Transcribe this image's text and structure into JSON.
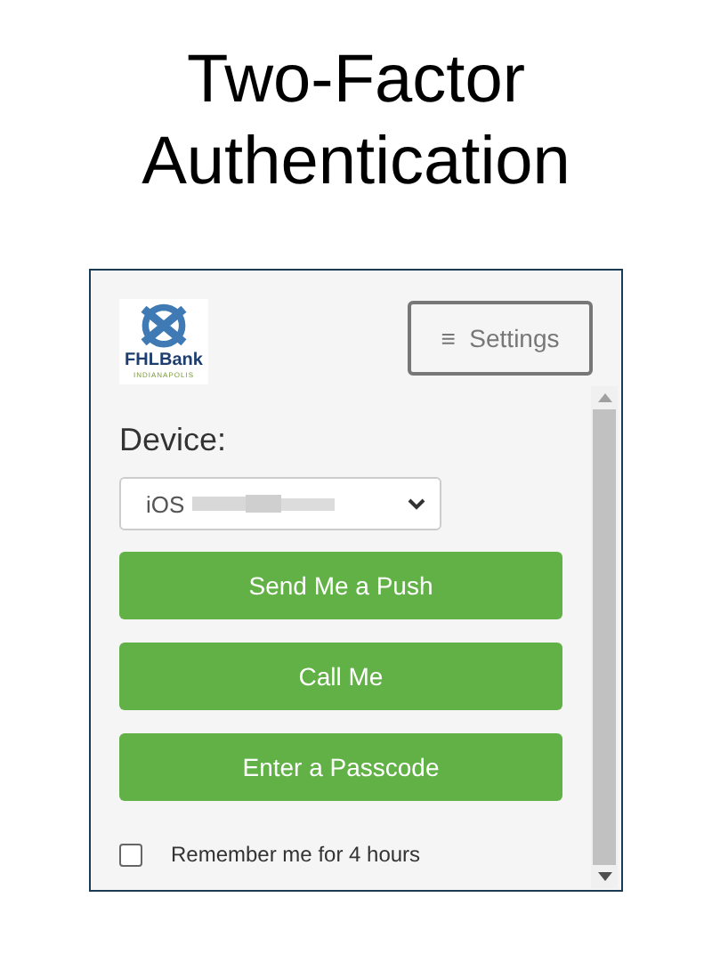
{
  "title": "Two-Factor Authentication",
  "logo": {
    "name": "FHLBank",
    "subtitle": "INDIANAPOLIS"
  },
  "settings_button": {
    "icon": "≡",
    "label": "Settings"
  },
  "device": {
    "label": "Device:",
    "value": "iOS"
  },
  "buttons": [
    "Send Me a Push",
    "Call Me",
    "Enter a Passcode"
  ],
  "remember": {
    "label": "Remember me for 4 hours",
    "checked": false
  }
}
